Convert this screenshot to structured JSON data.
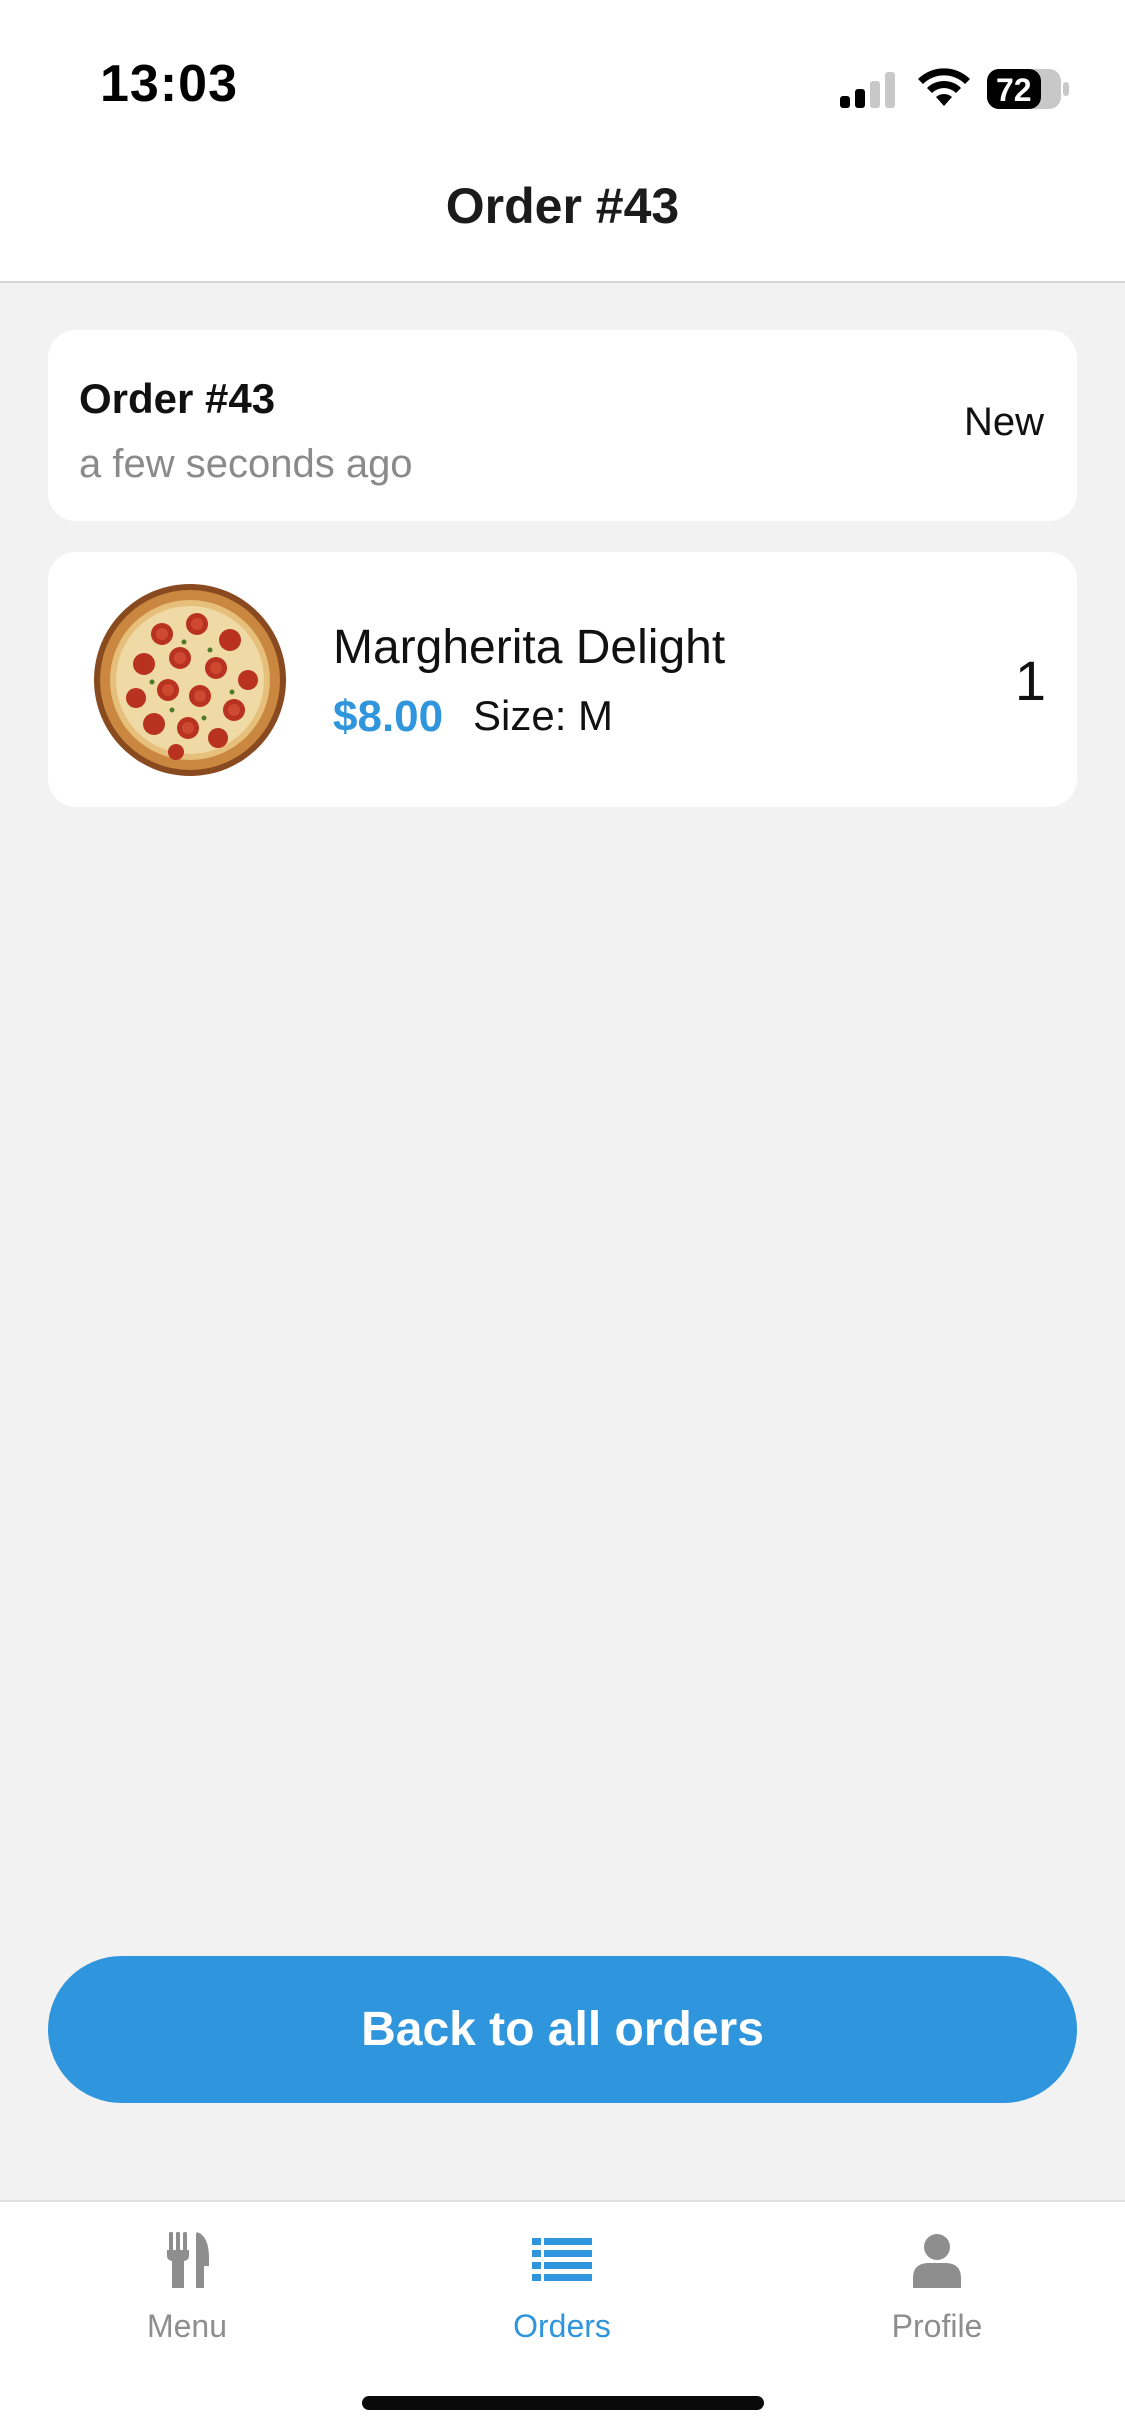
{
  "status_bar": {
    "time": "13:03",
    "battery_level": "72",
    "icons": [
      "signal-icon",
      "wifi-icon",
      "battery-icon"
    ]
  },
  "header": {
    "title": "Order #43"
  },
  "order_summary": {
    "title": "Order #43",
    "time_ago": "a few seconds ago",
    "status": "New"
  },
  "items": [
    {
      "name": "Margherita Delight",
      "price": "$8.00",
      "size": "Size: M",
      "quantity": "1",
      "image": "pizza-image"
    }
  ],
  "actions": {
    "back_label": "Back to all orders"
  },
  "tab_bar": {
    "tabs": [
      {
        "label": "Menu",
        "icon": "cutlery-icon",
        "active": false
      },
      {
        "label": "Orders",
        "icon": "list-icon",
        "active": true
      },
      {
        "label": "Profile",
        "icon": "user-icon",
        "active": false
      }
    ]
  },
  "colors": {
    "accent": "#2f95dc",
    "background": "#f2f2f2",
    "card": "#ffffff",
    "muted_text": "#8a8a8a"
  }
}
